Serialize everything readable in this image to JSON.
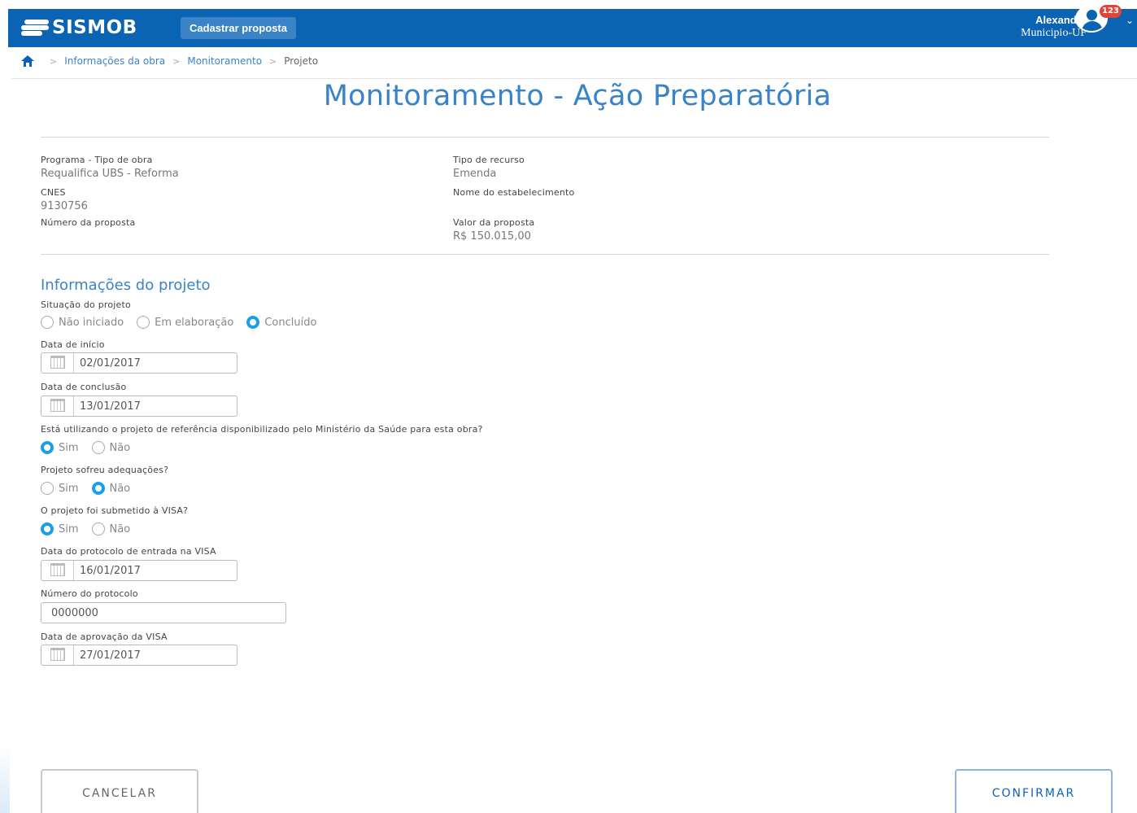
{
  "header": {
    "logo_text": "SISMOB",
    "cadastrar_label": "Cadastrar proposta",
    "user_name": "Alexandre",
    "user_municipio": "Municipio-UF",
    "notification_count": "123"
  },
  "breadcrumb": {
    "items": [
      "Informações da obra",
      "Monitoramento"
    ],
    "current": "Projeto",
    "separator": ">"
  },
  "page_title": "Monitoramento - Ação Preparatória",
  "info": {
    "programa_label": "Programa - Tipo de obra",
    "programa_value": "Requalifica UBS - Reforma",
    "cnes_label": "CNES",
    "cnes_value": "9130756",
    "numero_label": "Número da proposta",
    "recurso_label": "Tipo de recurso",
    "recurso_value": "Emenda",
    "estabelecimento_label": "Nome do estabelecimento",
    "valor_label": "Valor da proposta",
    "valor_value": "R$ 150.015,00"
  },
  "project": {
    "section_title": "Informações do projeto",
    "situacao_label": "Situação do projeto",
    "situacao_options": [
      "Não iniciado",
      "Em elaboração",
      "Concluído"
    ],
    "situacao_selected": "Concluído",
    "inicio_label": "Data de início",
    "inicio_value": "02/01/2017",
    "conclusao_label": "Data de conclusão",
    "conclusao_value": "13/01/2017",
    "referencia_label": "Está utilizando o projeto de referência disponibilizado pelo Ministério da Saúde para esta obra?",
    "adequacoes_label": "Projeto sofreu adequações?",
    "visa_label": "O projeto foi submetido à VISA?",
    "yes_label": "Sim",
    "no_label": "Não",
    "referencia_selected": "Sim",
    "adequacoes_selected": "Não",
    "visa_selected": "Sim",
    "protocolo_data_label": "Data do protocolo de entrada na VISA",
    "protocolo_data_value": "16/01/2017",
    "protocolo_numero_label": "Número do protocolo",
    "protocolo_numero_value": "0000000",
    "aprovacao_label": "Data de aprovação da VISA",
    "aprovacao_value": "27/01/2017"
  },
  "actions": {
    "cancel_label": "CANCELAR",
    "confirm_label": "CONFIRMAR"
  },
  "colors": {
    "primary": "#0a63b3",
    "accent": "#3a83c6",
    "radio_selected": "#1aa0e8",
    "badge": "#e0453a"
  }
}
